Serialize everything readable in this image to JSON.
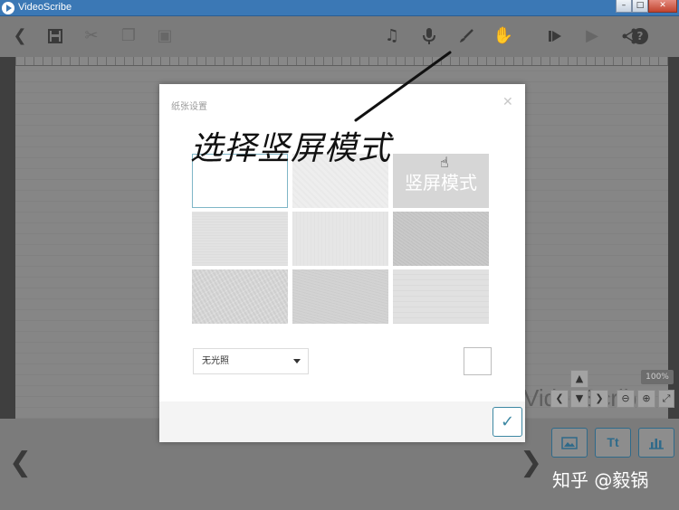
{
  "window": {
    "title": "VideoScribe"
  },
  "toolbar": {
    "icons": [
      "back-icon",
      "save-icon",
      "cut-icon",
      "copy-icon",
      "paste-icon",
      "music-icon",
      "microphone-icon",
      "brush-icon",
      "hand-icon",
      "play-from-icon",
      "play-icon",
      "share-icon",
      "help-icon"
    ],
    "help_label": "?"
  },
  "canvas": {
    "background_text": "VideoScribe",
    "zoom_level": "100%"
  },
  "modal": {
    "title": "纸张设置",
    "annotation": "选择竖屏模式",
    "tile_overlay_label": "竖屏模式",
    "lighting_select": {
      "value": "无光照"
    },
    "swatch_color": "#ffffff"
  },
  "timeline": {
    "image_button": "image-icon",
    "text_button_label": "Tt",
    "chart_button": "chart-icon"
  },
  "watermark": "知乎 @毅锅"
}
